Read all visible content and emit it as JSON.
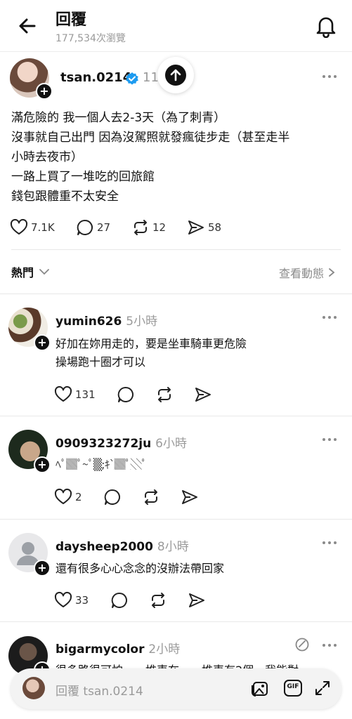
{
  "header": {
    "title": "回覆",
    "views": "177,534次瀏覽"
  },
  "post": {
    "username": "tsan.0214",
    "time": "11",
    "lines": [
      "滿危險的 我一個人去2-3天（為了刺青）",
      "沒事就自己出門 因為沒駕照就發瘋徒步走（甚至走半",
      "小時去夜市）",
      "一路上買了一堆吃的回旅館",
      "錢包跟體重不太安全"
    ],
    "likes": "7.1K",
    "comments": "27",
    "reposts": "12",
    "shares": "58"
  },
  "sort": {
    "label": "熱門",
    "activity_label": "查看動態"
  },
  "replies": [
    {
      "username": "yumin626",
      "time": "5小時",
      "lines": [
        "好加在妳用走的，要是坐車騎車更危險",
        "操場跑十圈才可以"
      ],
      "likes": "131"
    },
    {
      "username": "0909323272ju",
      "time": "6小時",
      "lines": [
        "ﾍﾟ▓ﾟ~ﾟ▒;ｷ`▓ﾟ░ﾟ"
      ],
      "likes": "2"
    },
    {
      "username": "daysheep2000",
      "time": "8小時",
      "lines": [
        "還有很多心心念念的沒辦法帶回家"
      ],
      "likes": "33"
    },
    {
      "username": "bigarmycolor",
      "time": "2小時",
      "lines": [
        "很多路很可怕，一堆車在……堆車有2個，我能對"
      ],
      "likes": ""
    }
  ],
  "composer": {
    "placeholder": "回覆 tsan.0214",
    "gif_label": "GIF"
  },
  "icons": {
    "back": "arrow-left-icon",
    "notifications": "bell-icon",
    "verified": "verified-badge-icon",
    "scroll_top": "arrow-up-icon",
    "like": "heart-icon",
    "comment": "comment-bubble-icon",
    "repost": "repost-icon",
    "share": "send-icon",
    "more": "more-dots-icon",
    "image": "image-icon",
    "gif": "gif-icon",
    "expand": "expand-icon"
  },
  "colors": {
    "accent": "#111111",
    "verified_blue": "#1d9bf0",
    "muted": "#9a9a9a"
  }
}
